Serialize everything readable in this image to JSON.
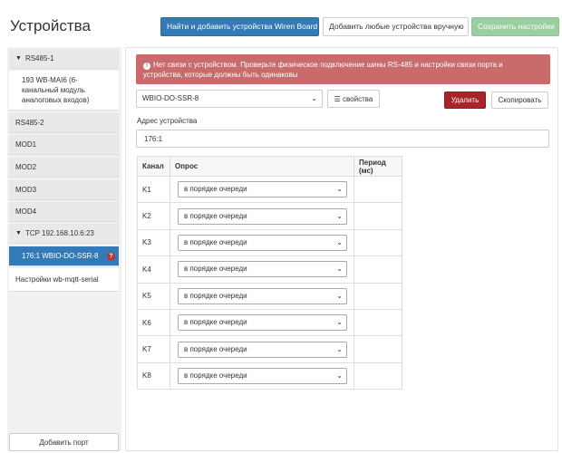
{
  "header": {
    "title": "Устройства",
    "btn_find": "Найти и добавить устройства Wiren Board",
    "btn_add_manual": "Добавить любые устройства вручную",
    "btn_save": "Сохранить настройки"
  },
  "sidebar": {
    "items": [
      {
        "label": "RS485-1"
      },
      {
        "label": "193 WB-MAI6 (6-канальный модуль аналоговых входов)"
      },
      {
        "label": "RS485-2"
      },
      {
        "label": "MOD1"
      },
      {
        "label": "MOD2"
      },
      {
        "label": "MOD3"
      },
      {
        "label": "MOD4"
      },
      {
        "label": "TCP 192.168.10.6:23"
      },
      {
        "label": "176:1 WBIO-DO-SSR-8"
      },
      {
        "label": "Настройки wb-mqtt-serial"
      }
    ],
    "error_mark": "?",
    "add_port": "Добавить порт"
  },
  "alert": {
    "text": "Нет связи с устройством. Проверьте физическое подключение шины RS-485 и настройки связи порта и устройства, которые должны быть одинаковы"
  },
  "device": {
    "type_value": "WBIO-DO-SSR-8",
    "props_label": "свойства",
    "delete_label": "Удалить",
    "copy_label": "Скопировать",
    "address_label": "Адрес устройства",
    "address_value": "176:1"
  },
  "channels": {
    "headers": {
      "channel": "Канал",
      "poll": "Опрос",
      "period": "Период (мс)"
    },
    "rows": [
      {
        "name": "K1",
        "poll": "в порядке очереди"
      },
      {
        "name": "K2",
        "poll": "в порядке очереди"
      },
      {
        "name": "K3",
        "poll": "в порядке очереди"
      },
      {
        "name": "K4",
        "poll": "в порядке очереди"
      },
      {
        "name": "K5",
        "poll": "в порядке очереди"
      },
      {
        "name": "K6",
        "poll": "в порядке очереди"
      },
      {
        "name": "K7",
        "poll": "в порядке очереди"
      },
      {
        "name": "K8",
        "poll": "в порядке очереди"
      }
    ]
  },
  "colors": {
    "primary": "#337ab7",
    "success": "#9bcea0",
    "danger": "#a9232a",
    "alert": "#c96b6b"
  }
}
